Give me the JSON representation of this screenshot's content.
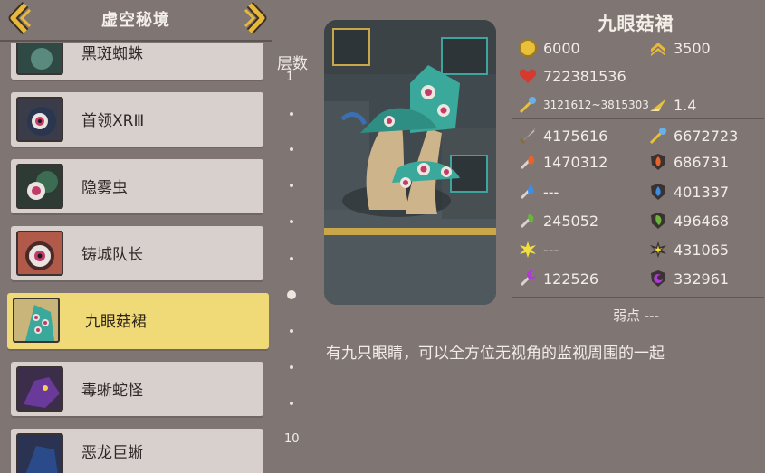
{
  "header": {
    "title": "虚空秘境"
  },
  "list": {
    "items": [
      {
        "name": "黑斑蜘蛛"
      },
      {
        "name": "首领XRⅢ"
      },
      {
        "name": "隐雾虫"
      },
      {
        "name": "铸城队长"
      },
      {
        "name": "九眼菇裙"
      },
      {
        "name": "毒蜥蛇怪"
      },
      {
        "name": "恶龙巨蜥"
      }
    ],
    "active_index": 4
  },
  "layers": {
    "title": "层数",
    "start": "1",
    "end": "10"
  },
  "boss": {
    "name": "九眼菇裙",
    "gold": "6000",
    "rank": "3500",
    "hp": "722381536",
    "attack_range": "3121612~3815303",
    "speed": "1.4",
    "phys_atk": "4175616",
    "phys_def": "6672723",
    "fire_atk": "1470312",
    "fire_def": "686731",
    "water_atk": "---",
    "water_def": "401337",
    "wind_atk": "245052",
    "wind_def": "496468",
    "light_atk": "---",
    "light_def": "431065",
    "dark_atk": "122526",
    "dark_def": "332961",
    "weakness": "弱点 ---",
    "description": "有九只眼睛，可以全方位无视角的监视周围的一起"
  },
  "colors": {
    "active_item": "#f0d977",
    "item_bg": "#d8d0cc",
    "background": "#7f7674"
  }
}
